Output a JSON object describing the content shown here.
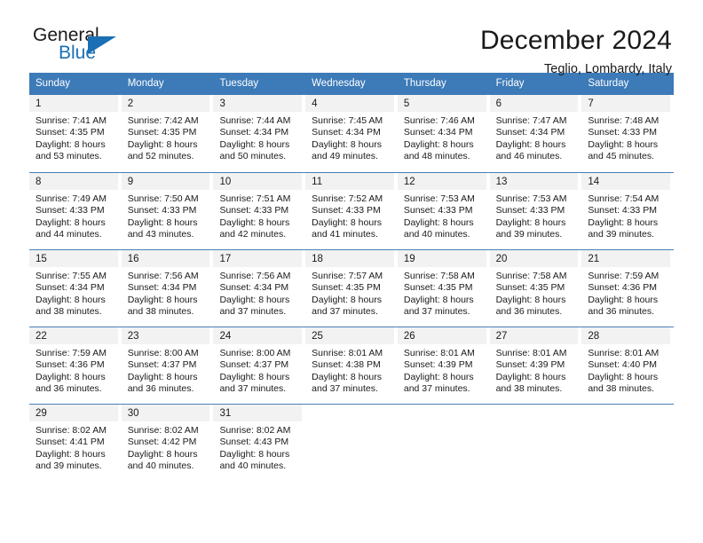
{
  "brand": {
    "name_part1": "General",
    "name_part2": "Blue",
    "accent_color": "#1a6fb5"
  },
  "header": {
    "title": "December 2024",
    "subtitle": "Teglio, Lombardy, Italy"
  },
  "calendar": {
    "header_bg": "#3c7ab8",
    "daynum_bg": "#f2f2f2",
    "weekdays": [
      "Sunday",
      "Monday",
      "Tuesday",
      "Wednesday",
      "Thursday",
      "Friday",
      "Saturday"
    ],
    "weeks": [
      [
        {
          "day": "1",
          "sunrise": "Sunrise: 7:41 AM",
          "sunset": "Sunset: 4:35 PM",
          "daylight1": "Daylight: 8 hours",
          "daylight2": "and 53 minutes."
        },
        {
          "day": "2",
          "sunrise": "Sunrise: 7:42 AM",
          "sunset": "Sunset: 4:35 PM",
          "daylight1": "Daylight: 8 hours",
          "daylight2": "and 52 minutes."
        },
        {
          "day": "3",
          "sunrise": "Sunrise: 7:44 AM",
          "sunset": "Sunset: 4:34 PM",
          "daylight1": "Daylight: 8 hours",
          "daylight2": "and 50 minutes."
        },
        {
          "day": "4",
          "sunrise": "Sunrise: 7:45 AM",
          "sunset": "Sunset: 4:34 PM",
          "daylight1": "Daylight: 8 hours",
          "daylight2": "and 49 minutes."
        },
        {
          "day": "5",
          "sunrise": "Sunrise: 7:46 AM",
          "sunset": "Sunset: 4:34 PM",
          "daylight1": "Daylight: 8 hours",
          "daylight2": "and 48 minutes."
        },
        {
          "day": "6",
          "sunrise": "Sunrise: 7:47 AM",
          "sunset": "Sunset: 4:34 PM",
          "daylight1": "Daylight: 8 hours",
          "daylight2": "and 46 minutes."
        },
        {
          "day": "7",
          "sunrise": "Sunrise: 7:48 AM",
          "sunset": "Sunset: 4:33 PM",
          "daylight1": "Daylight: 8 hours",
          "daylight2": "and 45 minutes."
        }
      ],
      [
        {
          "day": "8",
          "sunrise": "Sunrise: 7:49 AM",
          "sunset": "Sunset: 4:33 PM",
          "daylight1": "Daylight: 8 hours",
          "daylight2": "and 44 minutes."
        },
        {
          "day": "9",
          "sunrise": "Sunrise: 7:50 AM",
          "sunset": "Sunset: 4:33 PM",
          "daylight1": "Daylight: 8 hours",
          "daylight2": "and 43 minutes."
        },
        {
          "day": "10",
          "sunrise": "Sunrise: 7:51 AM",
          "sunset": "Sunset: 4:33 PM",
          "daylight1": "Daylight: 8 hours",
          "daylight2": "and 42 minutes."
        },
        {
          "day": "11",
          "sunrise": "Sunrise: 7:52 AM",
          "sunset": "Sunset: 4:33 PM",
          "daylight1": "Daylight: 8 hours",
          "daylight2": "and 41 minutes."
        },
        {
          "day": "12",
          "sunrise": "Sunrise: 7:53 AM",
          "sunset": "Sunset: 4:33 PM",
          "daylight1": "Daylight: 8 hours",
          "daylight2": "and 40 minutes."
        },
        {
          "day": "13",
          "sunrise": "Sunrise: 7:53 AM",
          "sunset": "Sunset: 4:33 PM",
          "daylight1": "Daylight: 8 hours",
          "daylight2": "and 39 minutes."
        },
        {
          "day": "14",
          "sunrise": "Sunrise: 7:54 AM",
          "sunset": "Sunset: 4:33 PM",
          "daylight1": "Daylight: 8 hours",
          "daylight2": "and 39 minutes."
        }
      ],
      [
        {
          "day": "15",
          "sunrise": "Sunrise: 7:55 AM",
          "sunset": "Sunset: 4:34 PM",
          "daylight1": "Daylight: 8 hours",
          "daylight2": "and 38 minutes."
        },
        {
          "day": "16",
          "sunrise": "Sunrise: 7:56 AM",
          "sunset": "Sunset: 4:34 PM",
          "daylight1": "Daylight: 8 hours",
          "daylight2": "and 38 minutes."
        },
        {
          "day": "17",
          "sunrise": "Sunrise: 7:56 AM",
          "sunset": "Sunset: 4:34 PM",
          "daylight1": "Daylight: 8 hours",
          "daylight2": "and 37 minutes."
        },
        {
          "day": "18",
          "sunrise": "Sunrise: 7:57 AM",
          "sunset": "Sunset: 4:35 PM",
          "daylight1": "Daylight: 8 hours",
          "daylight2": "and 37 minutes."
        },
        {
          "day": "19",
          "sunrise": "Sunrise: 7:58 AM",
          "sunset": "Sunset: 4:35 PM",
          "daylight1": "Daylight: 8 hours",
          "daylight2": "and 37 minutes."
        },
        {
          "day": "20",
          "sunrise": "Sunrise: 7:58 AM",
          "sunset": "Sunset: 4:35 PM",
          "daylight1": "Daylight: 8 hours",
          "daylight2": "and 36 minutes."
        },
        {
          "day": "21",
          "sunrise": "Sunrise: 7:59 AM",
          "sunset": "Sunset: 4:36 PM",
          "daylight1": "Daylight: 8 hours",
          "daylight2": "and 36 minutes."
        }
      ],
      [
        {
          "day": "22",
          "sunrise": "Sunrise: 7:59 AM",
          "sunset": "Sunset: 4:36 PM",
          "daylight1": "Daylight: 8 hours",
          "daylight2": "and 36 minutes."
        },
        {
          "day": "23",
          "sunrise": "Sunrise: 8:00 AM",
          "sunset": "Sunset: 4:37 PM",
          "daylight1": "Daylight: 8 hours",
          "daylight2": "and 36 minutes."
        },
        {
          "day": "24",
          "sunrise": "Sunrise: 8:00 AM",
          "sunset": "Sunset: 4:37 PM",
          "daylight1": "Daylight: 8 hours",
          "daylight2": "and 37 minutes."
        },
        {
          "day": "25",
          "sunrise": "Sunrise: 8:01 AM",
          "sunset": "Sunset: 4:38 PM",
          "daylight1": "Daylight: 8 hours",
          "daylight2": "and 37 minutes."
        },
        {
          "day": "26",
          "sunrise": "Sunrise: 8:01 AM",
          "sunset": "Sunset: 4:39 PM",
          "daylight1": "Daylight: 8 hours",
          "daylight2": "and 37 minutes."
        },
        {
          "day": "27",
          "sunrise": "Sunrise: 8:01 AM",
          "sunset": "Sunset: 4:39 PM",
          "daylight1": "Daylight: 8 hours",
          "daylight2": "and 38 minutes."
        },
        {
          "day": "28",
          "sunrise": "Sunrise: 8:01 AM",
          "sunset": "Sunset: 4:40 PM",
          "daylight1": "Daylight: 8 hours",
          "daylight2": "and 38 minutes."
        }
      ],
      [
        {
          "day": "29",
          "sunrise": "Sunrise: 8:02 AM",
          "sunset": "Sunset: 4:41 PM",
          "daylight1": "Daylight: 8 hours",
          "daylight2": "and 39 minutes."
        },
        {
          "day": "30",
          "sunrise": "Sunrise: 8:02 AM",
          "sunset": "Sunset: 4:42 PM",
          "daylight1": "Daylight: 8 hours",
          "daylight2": "and 40 minutes."
        },
        {
          "day": "31",
          "sunrise": "Sunrise: 8:02 AM",
          "sunset": "Sunset: 4:43 PM",
          "daylight1": "Daylight: 8 hours",
          "daylight2": "and 40 minutes."
        },
        {
          "day": "",
          "sunrise": "",
          "sunset": "",
          "daylight1": "",
          "daylight2": ""
        },
        {
          "day": "",
          "sunrise": "",
          "sunset": "",
          "daylight1": "",
          "daylight2": ""
        },
        {
          "day": "",
          "sunrise": "",
          "sunset": "",
          "daylight1": "",
          "daylight2": ""
        },
        {
          "day": "",
          "sunrise": "",
          "sunset": "",
          "daylight1": "",
          "daylight2": ""
        }
      ]
    ]
  }
}
